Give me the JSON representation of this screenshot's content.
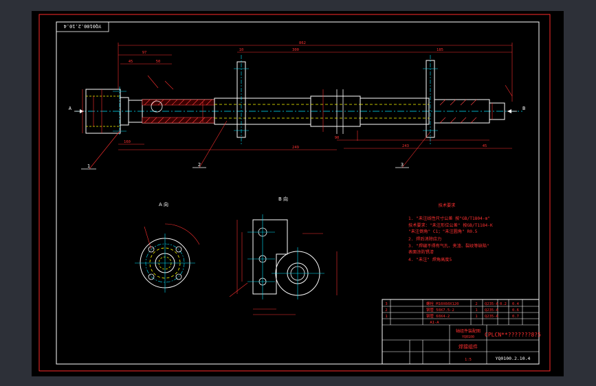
{
  "colors": {
    "background": "#2d3038",
    "viewport": "#000000",
    "border": "#ff2a2a",
    "geometry": "#ffffff",
    "dimension": "#ff3030",
    "centerline": "#00e5ff",
    "hidden": "#ffff00",
    "hatch": "#ff4040"
  },
  "drawing": {
    "code_top": "YQ0100.2.10.4",
    "code_bottom": "YQ0100.2.10.4",
    "view_a_label": "A 向",
    "view_b_label": "B 向",
    "arrow_a": "A",
    "arrow_b": "B",
    "dim_overall": "862",
    "dim_upper_mid": "300",
    "dim_upper_right": "185",
    "dim_upper_left_small": "10",
    "dim_left_97": "97",
    "dim_left_45": "45",
    "dim_left_50": "50",
    "dim_low_249": "249",
    "dim_low_90": "90",
    "dim_low_243": "243",
    "dim_low_45": "45",
    "dim_low_160": "160",
    "balloons": [
      "1",
      "2",
      "3"
    ],
    "tech_req_title": "技术要求",
    "tech_req_lines": [
      "1. \"未注线性尺寸公差 按\"GB/T1804-m\"",
      "   技术要求：\"未注形位公差\" 按GB/T1184-K",
      "   \"未注倒角\" C1；\"未注圆角\" R0.5",
      "2. 焊后消除应力",
      "3. \"焊缝不得有气孔、夹渣、裂纹等缺陷\"",
      "   表面涂防锈漆",
      "4. \"未注\"   焊角高度5"
    ],
    "bom_rows": [
      {
        "no": "3",
        "name": "螺栓 M10X60X120",
        "qty": "2",
        "mat": "Q235-A",
        "w": "0.2",
        "w2": "0.4"
      },
      {
        "no": "2",
        "name": "钢管 50X7.5-2",
        "qty": "1",
        "mat": "Q235-A",
        "w": "",
        "w2": "0.6"
      },
      {
        "no": "1",
        "name": "钢管 60X4-2",
        "qty": "1",
        "mat": "Q235-A",
        "w": "",
        "w2": "0.7"
      }
    ],
    "title_block_company": "CPLCN**???????8?5",
    "title_block_name": "轴组件装配图",
    "title_block_sub": "YQ0100",
    "title_block_part": "焊接组件",
    "title_block_scale": "1:5",
    "title_block_note_a": "A1-A"
  }
}
